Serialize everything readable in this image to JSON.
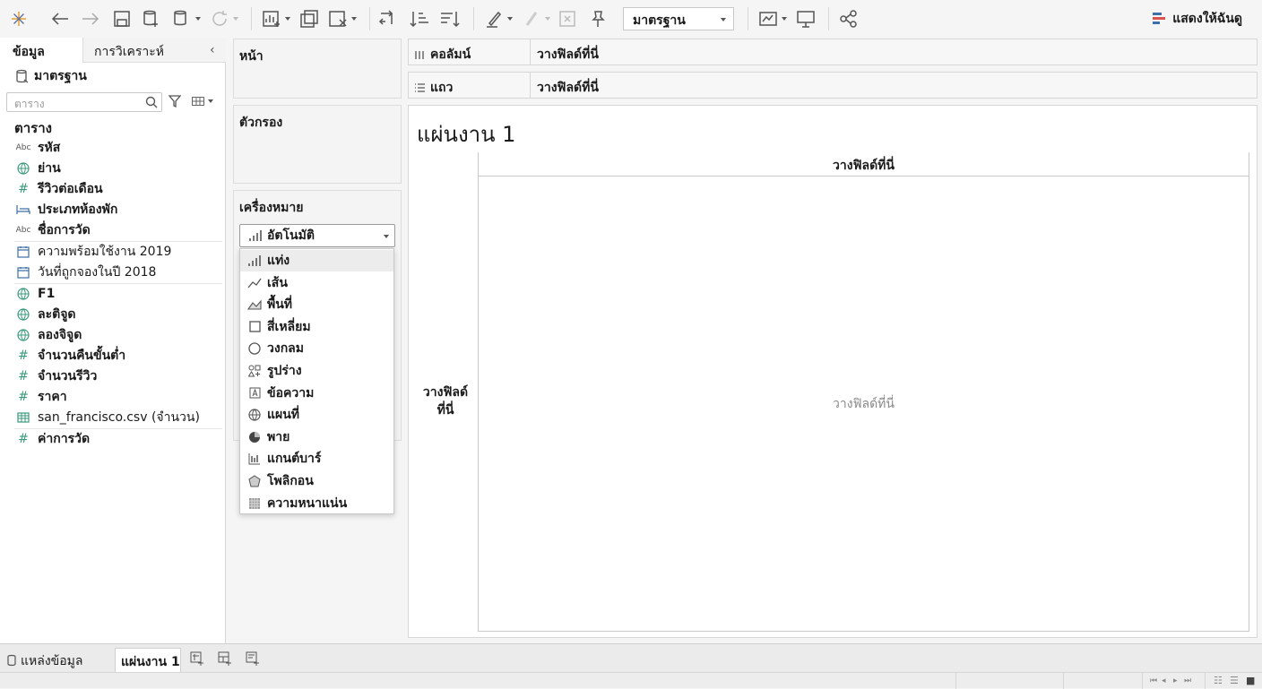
{
  "toolbar": {
    "datasource_select": "มาตรฐาน",
    "show_me": "แสดงให้ฉันดู"
  },
  "data_pane": {
    "tabs": [
      "ข้อมูล",
      "การวิเคราะห์"
    ],
    "datasource": "มาตรฐาน",
    "search_placeholder": "ตาราง",
    "section_title": "ตาราง",
    "fields": [
      {
        "label": "รหัส",
        "icon": "abc-icon"
      },
      {
        "label": "ย่าน",
        "icon": "globe-icon"
      },
      {
        "label": "รีวิวต่อเดือน",
        "icon": "hash-icon"
      },
      {
        "label": "ประเภทห้องพัก",
        "icon": "bed-icon"
      },
      {
        "label": "ชื่อการวัด",
        "icon": "abc-icon"
      },
      {
        "label": "ความพร้อมใช้งาน 2019",
        "icon": "calendar-icon"
      },
      {
        "label": "วันที่ถูกจองในปี 2018",
        "icon": "calendar-icon"
      },
      {
        "label": "F1",
        "icon": "globe-icon"
      },
      {
        "label": "ละติจูด",
        "icon": "globe-icon"
      },
      {
        "label": "ลองจิจูด",
        "icon": "globe-icon"
      },
      {
        "label": "จำนวนคืนขั้นต่ำ",
        "icon": "hash-icon"
      },
      {
        "label": "จำนวนรีวิว",
        "icon": "hash-icon"
      },
      {
        "label": "ราคา",
        "icon": "hash-icon"
      },
      {
        "label": "san_francisco.csv (จำนวน)",
        "icon": "table-icon"
      },
      {
        "label": "ค่าการวัด",
        "icon": "hash-icon"
      }
    ]
  },
  "cards": {
    "pages": "หน้า",
    "filters": "ตัวกรอง",
    "marks": "เครื่องหมาย",
    "marks_selected": "อัตโนมัติ"
  },
  "mark_types": [
    {
      "label": "แท่ง",
      "icon": "bar-icon"
    },
    {
      "label": "เส้น",
      "icon": "line-icon"
    },
    {
      "label": "พื้นที่",
      "icon": "area-icon"
    },
    {
      "label": "สี่เหลี่ยม",
      "icon": "square-icon"
    },
    {
      "label": "วงกลม",
      "icon": "circle-icon"
    },
    {
      "label": "รูปร่าง",
      "icon": "shape-icon"
    },
    {
      "label": "ข้อความ",
      "icon": "text-icon"
    },
    {
      "label": "แผนที่",
      "icon": "map-icon"
    },
    {
      "label": "พาย",
      "icon": "pie-icon"
    },
    {
      "label": "แกนต์บาร์",
      "icon": "gantt-icon"
    },
    {
      "label": "โพลิกอน",
      "icon": "polygon-icon"
    },
    {
      "label": "ความหนาแน่น",
      "icon": "density-icon"
    }
  ],
  "shelves": {
    "columns_label": "คอลัมน์",
    "columns_drop": "วางฟิลด์ที่นี่",
    "rows_label": "แถว",
    "rows_drop": "วางฟิลด์ที่นี่"
  },
  "sheet": {
    "title": "แผ่นงาน 1",
    "column_drop": "วางฟิลด์ที่นี่",
    "row_drop": "วางฟิลด์ที่นี่",
    "center_drop": "วางฟิลด์ที่นี่"
  },
  "bottom_tabs": {
    "datasource": "แหล่งข้อมูล",
    "sheet": "แผ่นงาน 1"
  }
}
